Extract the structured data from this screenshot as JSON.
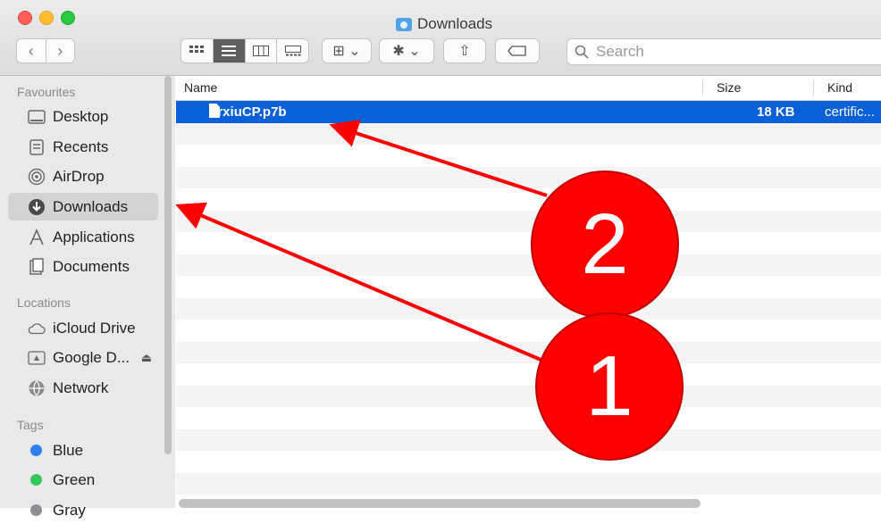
{
  "window": {
    "title": "Downloads"
  },
  "toolbar": {
    "back_glyph": "‹",
    "forward_glyph": "›",
    "views": [
      "icon-view",
      "list-view",
      "column-view",
      "gallery-view"
    ],
    "group_glyph": "⊞ ⌄",
    "action_glyph": "✱ ⌄",
    "share_glyph": "⇧",
    "tag_glyph": "⌂",
    "search_placeholder": "Search"
  },
  "sidebar": {
    "favourites_heading": "Favourites",
    "favourites": [
      {
        "label": "Desktop",
        "icon": "desktop-icon"
      },
      {
        "label": "Recents",
        "icon": "recents-icon"
      },
      {
        "label": "AirDrop",
        "icon": "airdrop-icon"
      },
      {
        "label": "Downloads",
        "icon": "downloads-icon",
        "selected": true
      },
      {
        "label": "Applications",
        "icon": "applications-icon"
      },
      {
        "label": "Documents",
        "icon": "documents-icon"
      }
    ],
    "locations_heading": "Locations",
    "locations": [
      {
        "label": "iCloud Drive",
        "icon": "cloud-icon"
      },
      {
        "label": "Google D...",
        "icon": "drive-icon",
        "eject": "⏏"
      },
      {
        "label": "Network",
        "icon": "network-icon"
      }
    ],
    "tags_heading": "Tags",
    "tags": [
      {
        "label": "Blue",
        "color": "#2f7ff0"
      },
      {
        "label": "Green",
        "color": "#34c759"
      },
      {
        "label": "Gray",
        "color": "#8e8e93"
      }
    ]
  },
  "list": {
    "columns": {
      "name": "Name",
      "size": "Size",
      "kind": "Kind"
    },
    "files": [
      {
        "name": "arxiuCP.p7b",
        "size": "18 KB",
        "kind": "certific..."
      }
    ]
  },
  "annotations": {
    "badge1": "1",
    "badge2": "2",
    "color": "#ff0000"
  }
}
